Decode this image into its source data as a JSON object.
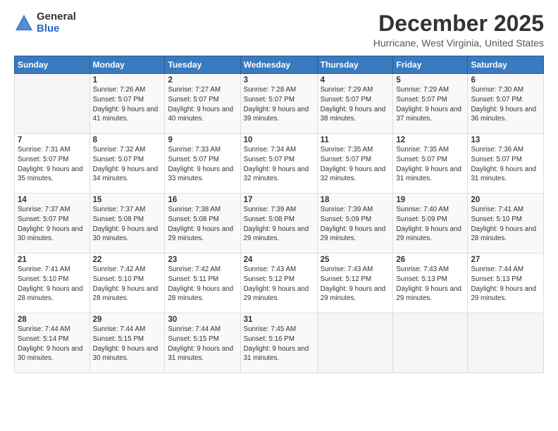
{
  "logo": {
    "general": "General",
    "blue": "Blue"
  },
  "title": "December 2025",
  "subtitle": "Hurricane, West Virginia, United States",
  "days_of_week": [
    "Sunday",
    "Monday",
    "Tuesday",
    "Wednesday",
    "Thursday",
    "Friday",
    "Saturday"
  ],
  "weeks": [
    [
      {
        "num": "",
        "sunrise": "",
        "sunset": "",
        "daylight": ""
      },
      {
        "num": "1",
        "sunrise": "Sunrise: 7:26 AM",
        "sunset": "Sunset: 5:07 PM",
        "daylight": "Daylight: 9 hours and 41 minutes."
      },
      {
        "num": "2",
        "sunrise": "Sunrise: 7:27 AM",
        "sunset": "Sunset: 5:07 PM",
        "daylight": "Daylight: 9 hours and 40 minutes."
      },
      {
        "num": "3",
        "sunrise": "Sunrise: 7:28 AM",
        "sunset": "Sunset: 5:07 PM",
        "daylight": "Daylight: 9 hours and 39 minutes."
      },
      {
        "num": "4",
        "sunrise": "Sunrise: 7:29 AM",
        "sunset": "Sunset: 5:07 PM",
        "daylight": "Daylight: 9 hours and 38 minutes."
      },
      {
        "num": "5",
        "sunrise": "Sunrise: 7:29 AM",
        "sunset": "Sunset: 5:07 PM",
        "daylight": "Daylight: 9 hours and 37 minutes."
      },
      {
        "num": "6",
        "sunrise": "Sunrise: 7:30 AM",
        "sunset": "Sunset: 5:07 PM",
        "daylight": "Daylight: 9 hours and 36 minutes."
      }
    ],
    [
      {
        "num": "7",
        "sunrise": "Sunrise: 7:31 AM",
        "sunset": "Sunset: 5:07 PM",
        "daylight": "Daylight: 9 hours and 35 minutes."
      },
      {
        "num": "8",
        "sunrise": "Sunrise: 7:32 AM",
        "sunset": "Sunset: 5:07 PM",
        "daylight": "Daylight: 9 hours and 34 minutes."
      },
      {
        "num": "9",
        "sunrise": "Sunrise: 7:33 AM",
        "sunset": "Sunset: 5:07 PM",
        "daylight": "Daylight: 9 hours and 33 minutes."
      },
      {
        "num": "10",
        "sunrise": "Sunrise: 7:34 AM",
        "sunset": "Sunset: 5:07 PM",
        "daylight": "Daylight: 9 hours and 32 minutes."
      },
      {
        "num": "11",
        "sunrise": "Sunrise: 7:35 AM",
        "sunset": "Sunset: 5:07 PM",
        "daylight": "Daylight: 9 hours and 32 minutes."
      },
      {
        "num": "12",
        "sunrise": "Sunrise: 7:35 AM",
        "sunset": "Sunset: 5:07 PM",
        "daylight": "Daylight: 9 hours and 31 minutes."
      },
      {
        "num": "13",
        "sunrise": "Sunrise: 7:36 AM",
        "sunset": "Sunset: 5:07 PM",
        "daylight": "Daylight: 9 hours and 31 minutes."
      }
    ],
    [
      {
        "num": "14",
        "sunrise": "Sunrise: 7:37 AM",
        "sunset": "Sunset: 5:07 PM",
        "daylight": "Daylight: 9 hours and 30 minutes."
      },
      {
        "num": "15",
        "sunrise": "Sunrise: 7:37 AM",
        "sunset": "Sunset: 5:08 PM",
        "daylight": "Daylight: 9 hours and 30 minutes."
      },
      {
        "num": "16",
        "sunrise": "Sunrise: 7:38 AM",
        "sunset": "Sunset: 5:08 PM",
        "daylight": "Daylight: 9 hours and 29 minutes."
      },
      {
        "num": "17",
        "sunrise": "Sunrise: 7:39 AM",
        "sunset": "Sunset: 5:08 PM",
        "daylight": "Daylight: 9 hours and 29 minutes."
      },
      {
        "num": "18",
        "sunrise": "Sunrise: 7:39 AM",
        "sunset": "Sunset: 5:09 PM",
        "daylight": "Daylight: 9 hours and 29 minutes."
      },
      {
        "num": "19",
        "sunrise": "Sunrise: 7:40 AM",
        "sunset": "Sunset: 5:09 PM",
        "daylight": "Daylight: 9 hours and 29 minutes."
      },
      {
        "num": "20",
        "sunrise": "Sunrise: 7:41 AM",
        "sunset": "Sunset: 5:10 PM",
        "daylight": "Daylight: 9 hours and 28 minutes."
      }
    ],
    [
      {
        "num": "21",
        "sunrise": "Sunrise: 7:41 AM",
        "sunset": "Sunset: 5:10 PM",
        "daylight": "Daylight: 9 hours and 28 minutes."
      },
      {
        "num": "22",
        "sunrise": "Sunrise: 7:42 AM",
        "sunset": "Sunset: 5:10 PM",
        "daylight": "Daylight: 9 hours and 28 minutes."
      },
      {
        "num": "23",
        "sunrise": "Sunrise: 7:42 AM",
        "sunset": "Sunset: 5:11 PM",
        "daylight": "Daylight: 9 hours and 28 minutes."
      },
      {
        "num": "24",
        "sunrise": "Sunrise: 7:43 AM",
        "sunset": "Sunset: 5:12 PM",
        "daylight": "Daylight: 9 hours and 29 minutes."
      },
      {
        "num": "25",
        "sunrise": "Sunrise: 7:43 AM",
        "sunset": "Sunset: 5:12 PM",
        "daylight": "Daylight: 9 hours and 29 minutes."
      },
      {
        "num": "26",
        "sunrise": "Sunrise: 7:43 AM",
        "sunset": "Sunset: 5:13 PM",
        "daylight": "Daylight: 9 hours and 29 minutes."
      },
      {
        "num": "27",
        "sunrise": "Sunrise: 7:44 AM",
        "sunset": "Sunset: 5:13 PM",
        "daylight": "Daylight: 9 hours and 29 minutes."
      }
    ],
    [
      {
        "num": "28",
        "sunrise": "Sunrise: 7:44 AM",
        "sunset": "Sunset: 5:14 PM",
        "daylight": "Daylight: 9 hours and 30 minutes."
      },
      {
        "num": "29",
        "sunrise": "Sunrise: 7:44 AM",
        "sunset": "Sunset: 5:15 PM",
        "daylight": "Daylight: 9 hours and 30 minutes."
      },
      {
        "num": "30",
        "sunrise": "Sunrise: 7:44 AM",
        "sunset": "Sunset: 5:15 PM",
        "daylight": "Daylight: 9 hours and 31 minutes."
      },
      {
        "num": "31",
        "sunrise": "Sunrise: 7:45 AM",
        "sunset": "Sunset: 5:16 PM",
        "daylight": "Daylight: 9 hours and 31 minutes."
      },
      {
        "num": "",
        "sunrise": "",
        "sunset": "",
        "daylight": ""
      },
      {
        "num": "",
        "sunrise": "",
        "sunset": "",
        "daylight": ""
      },
      {
        "num": "",
        "sunrise": "",
        "sunset": "",
        "daylight": ""
      }
    ]
  ]
}
